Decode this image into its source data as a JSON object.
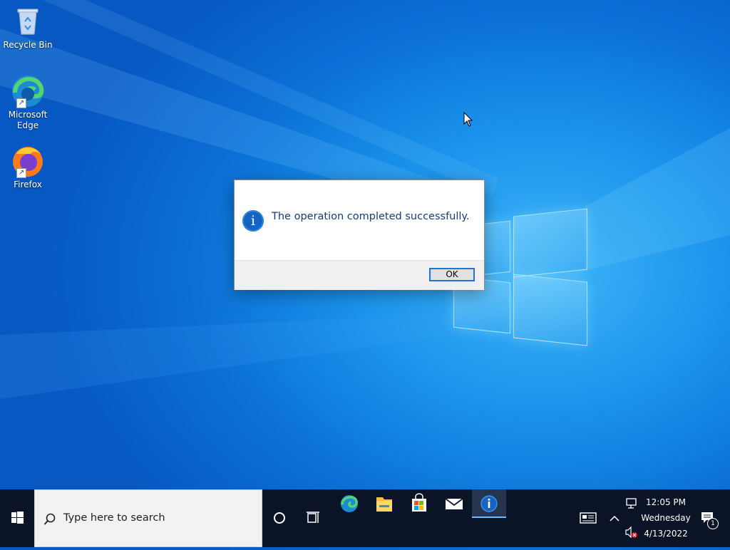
{
  "desktop": {
    "icons": [
      {
        "label": "Recycle Bin"
      },
      {
        "label": "Microsoft\nEdge"
      },
      {
        "label": "Firefox"
      }
    ]
  },
  "dialog": {
    "message": "The operation completed successfully.",
    "ok_label": "OK",
    "icon": "information-icon"
  },
  "taskbar": {
    "search_placeholder": "Type here to search",
    "pinned_apps": [
      "cortana-icon",
      "task-view-icon",
      "edge-icon",
      "file-explorer-icon",
      "microsoft-store-icon",
      "mail-icon",
      "information-app-icon"
    ],
    "clock": {
      "time": "12:05 PM",
      "day": "Wednesday",
      "date": "4/13/2022"
    },
    "notification_count": "1"
  },
  "colors": {
    "taskbar_bg": "#0b1427",
    "accent": "#1979d2",
    "message_text": "#1a3a7a"
  }
}
